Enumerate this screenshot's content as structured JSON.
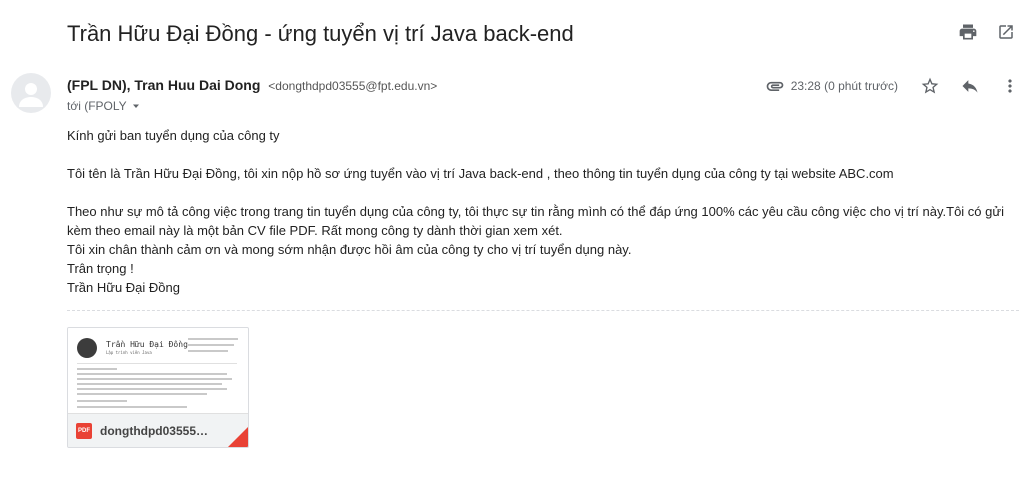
{
  "subject": "Trần Hữu Đại Đồng - ứng tuyển vị trí Java back-end",
  "sender": {
    "name": "(FPL DN), Tran Huu Dai Dong",
    "email": "<dongthdpd03555@fpt.edu.vn>",
    "to_label": "tới (FPOLY"
  },
  "meta": {
    "time": "23:28 (0 phút trước)"
  },
  "body": {
    "line1": "Kính gửi ban tuyển dụng của công ty",
    "line2": "Tôi tên là Trần Hữu Đại Đồng, tôi xin nộp hồ sơ ứng tuyển vào vị trí Java back-end , theo thông tin tuyển dụng của công ty tại website ABC.com",
    "line3": "Theo như sự mô tả công việc trong trang tin tuyển dụng của công ty, tôi thực sự tin rằng mình có thể đáp ứng 100% các yêu cầu công việc cho vị trí này.Tôi có gửi kèm theo email này là một bản CV file PDF. Rất mong công ty dành thời gian xem xét.",
    "line4": "Tôi xin chân thành cảm ơn và mong sớm nhận được hồi âm của công ty cho vị trí tuyển dụng này.",
    "line5": "Trân trọng !",
    "line6": "Trần Hữu Đại Đồng"
  },
  "attachment": {
    "badge": "PDF",
    "filename": "dongthdpd03555_...",
    "thumb_name": "Trần Hữu Đại Đồng",
    "thumb_role": "Lập trình viên Java"
  },
  "icons": {
    "print": "print-icon",
    "open_new": "open-in-new-icon",
    "attachment": "paperclip-icon",
    "star": "star-icon",
    "reply": "reply-icon",
    "more": "more-vert-icon",
    "dropdown": "caret-down-icon",
    "avatar": "person-icon"
  }
}
